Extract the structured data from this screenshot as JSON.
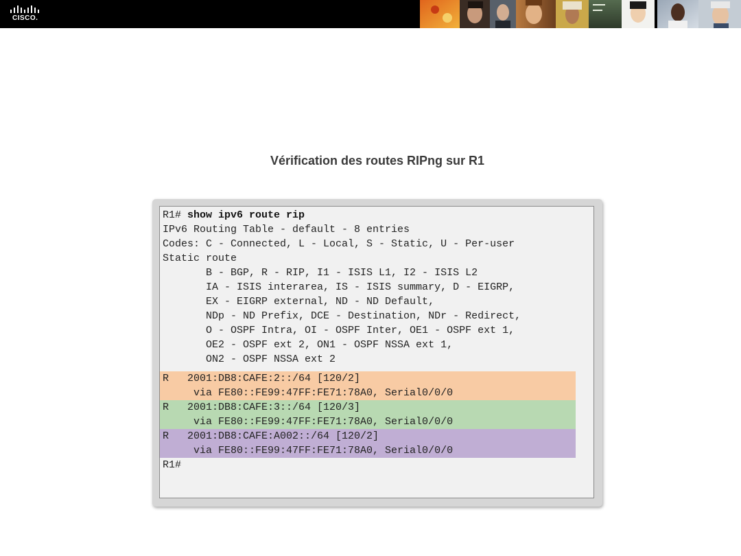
{
  "brand": {
    "logo_text": "CISCO.",
    "header_color": "#000000"
  },
  "slide": {
    "title": "Vérification des routes RIPng sur R1"
  },
  "terminal": {
    "prompt": "R1# ",
    "command": "show ipv6 route rip",
    "lines": [
      "IPv6 Routing Table - default - 8 entries",
      "Codes: C - Connected, L - Local, S - Static, U - Per-user",
      "Static route",
      "       B - BGP, R - RIP, I1 - ISIS L1, I2 - ISIS L2",
      "       IA - ISIS interarea, IS - ISIS summary, D - EIGRP,",
      "       EX - EIGRP external, ND - ND Default,",
      "       NDp - ND Prefix, DCE - Destination, NDr - Redirect,",
      "       O - OSPF Intra, OI - OSPF Inter, OE1 - OSPF ext 1,",
      "       OE2 - OSPF ext 2, ON1 - OSPF NSSA ext 1,",
      "       ON2 - OSPF NSSA ext 2"
    ],
    "routes": [
      {
        "prefix_line": "R   2001:DB8:CAFE:2::/64 [120/2]",
        "via_line": "     via FE80::FE99:47FF:FE71:78A0, Serial0/0/0",
        "highlight": "#f8cba4"
      },
      {
        "prefix_line": "R   2001:DB8:CAFE:3::/64 [120/3]",
        "via_line": "     via FE80::FE99:47FF:FE71:78A0, Serial0/0/0",
        "highlight": "#b8d9b2"
      },
      {
        "prefix_line": "R   2001:DB8:CAFE:A002::/64 [120/2]",
        "via_line": "     via FE80::FE99:47FF:FE71:78A0, Serial0/0/0",
        "highlight": "#c0aed4"
      }
    ],
    "final_prompt": "R1#"
  }
}
